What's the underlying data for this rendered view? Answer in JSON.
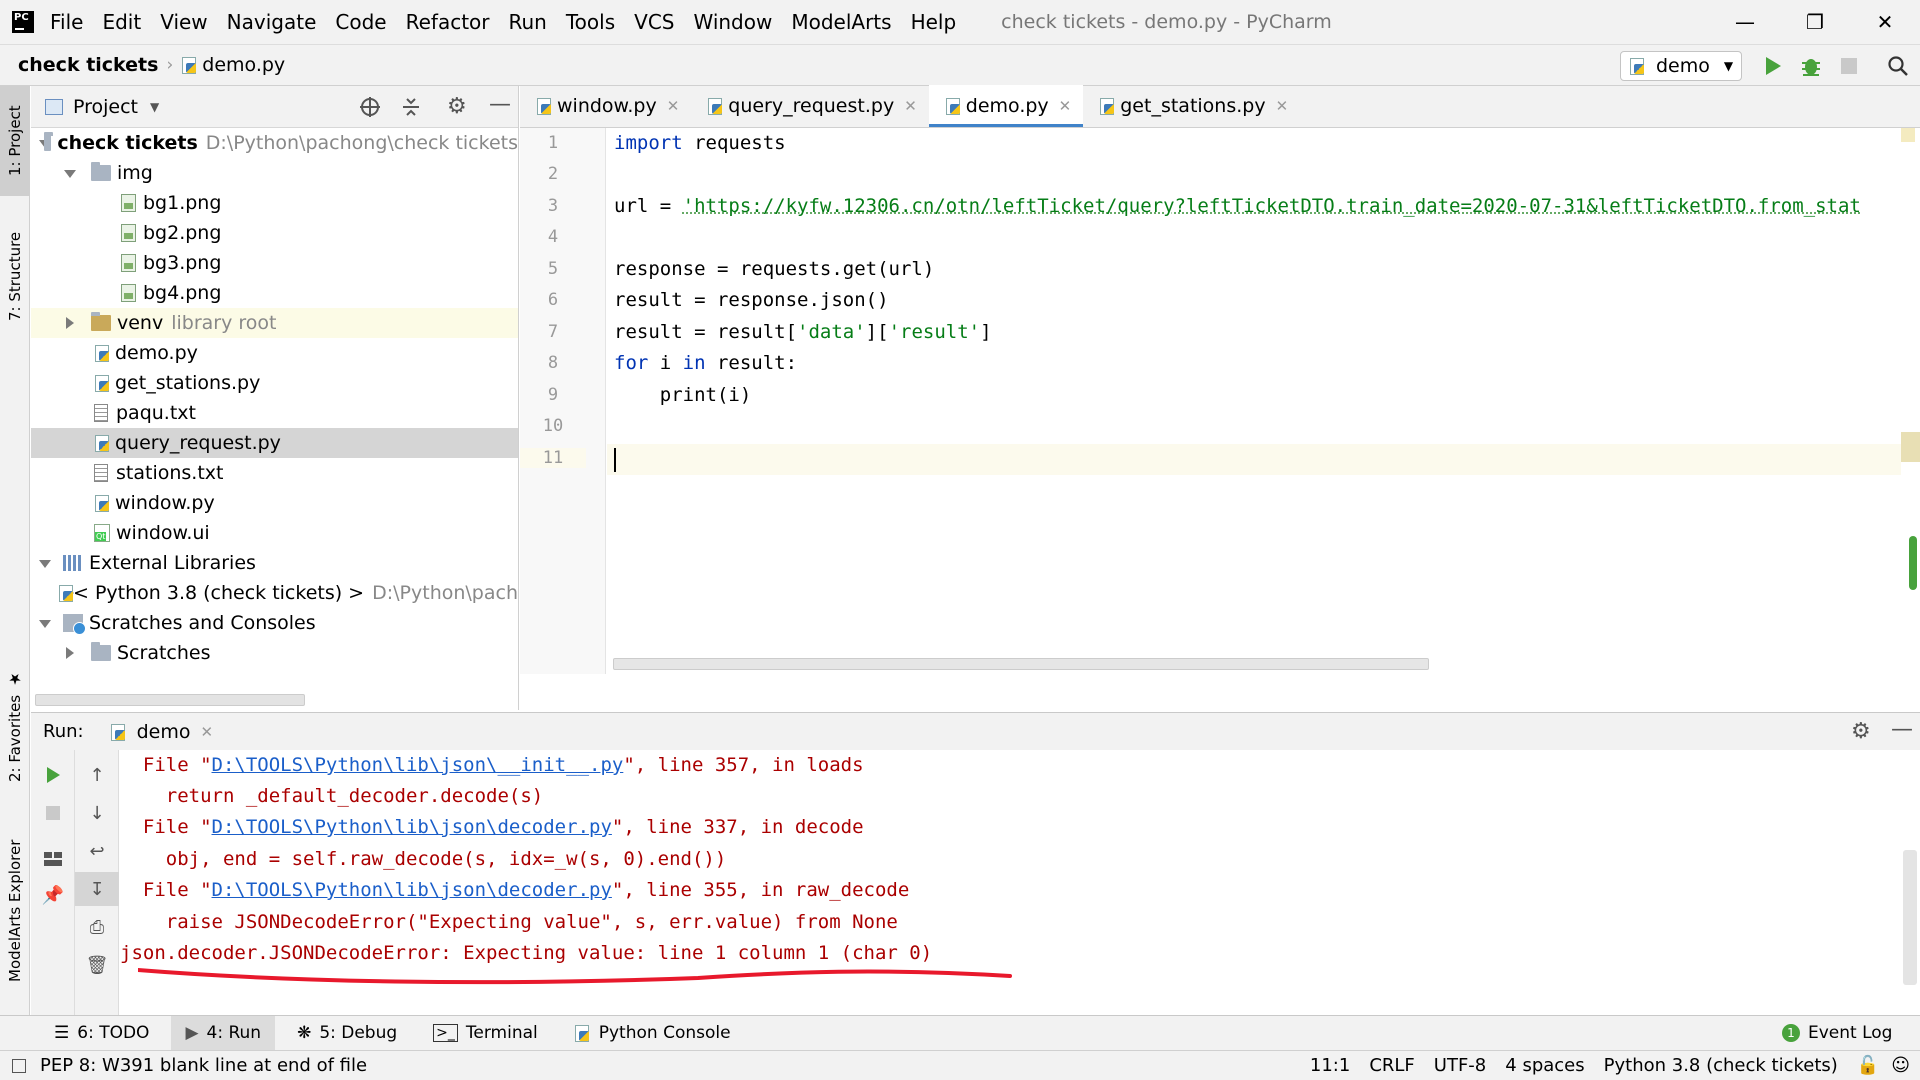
{
  "app": {
    "window_title": "check tickets - demo.py - PyCharm",
    "menu": [
      "File",
      "Edit",
      "View",
      "Navigate",
      "Code",
      "Refactor",
      "Run",
      "Tools",
      "VCS",
      "Window",
      "ModelArts",
      "Help"
    ]
  },
  "navbar": {
    "project": "check tickets",
    "file": "demo.py",
    "run_config": "demo"
  },
  "left_strip": {
    "project": "1: Project",
    "structure": "7: Structure",
    "favorites": "2: Favorites",
    "modelarts": "ModelArts Explorer"
  },
  "project_panel": {
    "title": "Project",
    "tree": [
      {
        "label": "check tickets",
        "hint": "D:\\Python\\pachong\\check tickets",
        "type": "root"
      },
      {
        "label": "img",
        "type": "folder"
      },
      {
        "label": "bg1.png",
        "type": "image"
      },
      {
        "label": "bg2.png",
        "type": "image"
      },
      {
        "label": "bg3.png",
        "type": "image"
      },
      {
        "label": "bg4.png",
        "type": "image"
      },
      {
        "label": "venv",
        "hint": "library root",
        "type": "folder"
      },
      {
        "label": "demo.py",
        "type": "python"
      },
      {
        "label": "get_stations.py",
        "type": "python"
      },
      {
        "label": "paqu.txt",
        "type": "text"
      },
      {
        "label": "query_request.py",
        "type": "python"
      },
      {
        "label": "stations.txt",
        "type": "text"
      },
      {
        "label": "window.py",
        "type": "python"
      },
      {
        "label": "window.ui",
        "type": "ui"
      },
      {
        "label": "External Libraries",
        "type": "library"
      },
      {
        "label": "< Python 3.8 (check tickets) >",
        "hint": "D:\\Python\\pach",
        "type": "python"
      },
      {
        "label": "Scratches and Consoles",
        "type": "scratch"
      },
      {
        "label": "Scratches",
        "type": "folder"
      }
    ]
  },
  "editor": {
    "tabs": [
      "window.py",
      "query_request.py",
      "demo.py",
      "get_stations.py"
    ],
    "active_tab": "demo.py",
    "line_numbers": [
      "1",
      "2",
      "3",
      "4",
      "5",
      "6",
      "7",
      "8",
      "9",
      "10",
      "11"
    ],
    "code": {
      "l1_kw": "import",
      "l1_rest": " requests",
      "l3_pre": "url = ",
      "l3_str": "'https://kyfw.12306.cn/otn/leftTicket/query?leftTicketDTO.train_date=2020-07-31&leftTicketDTO.from_stat",
      "l5": "response = requests.get(url)",
      "l6": "result = response.json()",
      "l7_pre": "result = result[",
      "l7_s1": "'data'",
      "l7_mid": "][",
      "l7_s2": "'result'",
      "l7_end": "]",
      "l8_kw1": "for",
      "l8_mid": " i ",
      "l8_kw2": "in",
      "l8_end": " result:",
      "l9": "    print(i)"
    }
  },
  "run_panel": {
    "label": "Run:",
    "tab": "demo",
    "lines": {
      "c1_pre": "  File \"",
      "c1_link": "D:\\TOOLS\\Python\\lib\\json\\__init__.py",
      "c1_post": "\", line 357, in loads",
      "c2": "    return _default_decoder.decode(s)",
      "c3_pre": "  File \"",
      "c3_link": "D:\\TOOLS\\Python\\lib\\json\\decoder.py",
      "c3_post": "\", line 337, in decode",
      "c4": "    obj, end = self.raw_decode(s, idx=_w(s, 0).end())",
      "c5_pre": "  File \"",
      "c5_link": "D:\\TOOLS\\Python\\lib\\json\\decoder.py",
      "c5_post": "\", line 355, in raw_decode",
      "c6": "    raise JSONDecodeError(\"Expecting value\", s, err.value) from None",
      "c7": "json.decoder.JSONDecodeError: Expecting value: line 1 column 1 (char 0)"
    }
  },
  "bottom_tabs": [
    "6: TODO",
    "4: Run",
    "5: Debug",
    "Terminal",
    "Python Console"
  ],
  "event_log": "Event Log",
  "status": {
    "message": "PEP 8: W391 blank line at end of file",
    "position": "11:1",
    "line_sep": "CRLF",
    "encoding": "UTF-8",
    "indent": "4 spaces",
    "interpreter": "Python 3.8 (check tickets)"
  },
  "colors": {
    "accent": "#4083c9",
    "error_text": "#aa0000",
    "annotation": "#e8192c"
  }
}
